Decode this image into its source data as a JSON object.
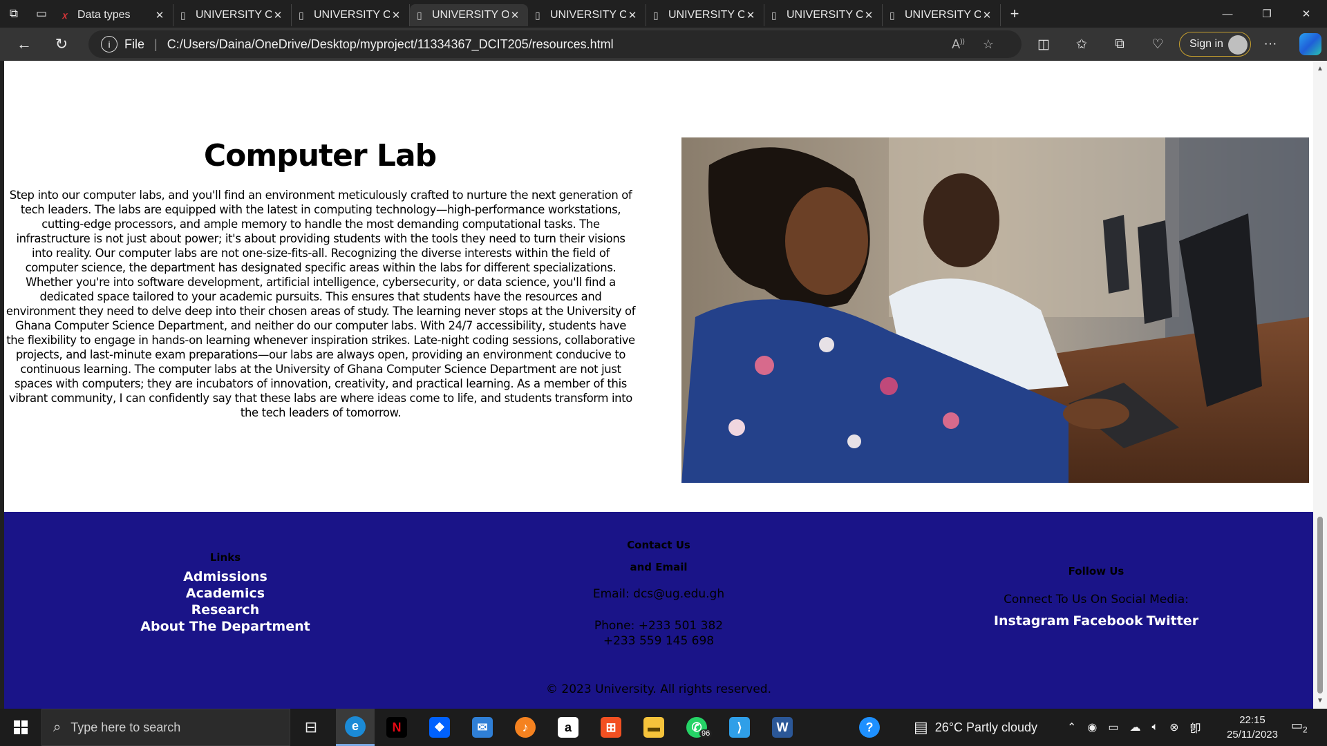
{
  "browser": {
    "tabs": [
      {
        "title": "Data types",
        "active": false
      },
      {
        "title": "UNIVERSITY OF GHANA",
        "active": false
      },
      {
        "title": "UNIVERSITY OF GHANA",
        "active": false
      },
      {
        "title": "UNIVERSITY OF GHANA",
        "active": true
      },
      {
        "title": "UNIVERSITY OF GHANA",
        "active": false
      },
      {
        "title": "UNIVERSITY OF GHANA",
        "active": false
      },
      {
        "title": "UNIVERSITY OF GHANA",
        "active": false
      },
      {
        "title": "UNIVERSITY OF GHANA",
        "active": false
      }
    ],
    "address": {
      "scheme_label": "File",
      "url": "C:/Users/Daina/OneDrive/Desktop/myproject/11334367_DCIT205/resources.html"
    },
    "signin_label": "Sign in"
  },
  "page": {
    "lab": {
      "title": "Computer Lab",
      "paragraph": "Step into our computer labs, and you'll find an environment meticulously crafted to nurture the next generation of tech leaders. The labs are equipped with the latest in computing technology—high-performance workstations, cutting-edge processors, and ample memory to handle the most demanding computational tasks. The infrastructure is not just about power; it's about providing students with the tools they need to turn their visions into reality. Our computer labs are not one-size-fits-all. Recognizing the diverse interests within the field of computer science, the department has designated specific areas within the labs for different specializations. Whether you're into software development, artificial intelligence, cybersecurity, or data science, you'll find a dedicated space tailored to your academic pursuits. This ensures that students have the resources and environment they need to delve deep into their chosen areas of study. The learning never stops at the University of Ghana Computer Science Department, and neither do our computer labs. With 24/7 accessibility, students have the flexibility to engage in hands-on learning whenever inspiration strikes. Late-night coding sessions, collaborative projects, and last-minute exam preparations—our labs are always open, providing an environment conducive to continuous learning. The computer labs at the University of Ghana Computer Science Department are not just spaces with computers; they are incubators of innovation, creativity, and practical learning. As a member of this vibrant community, I can confidently say that these labs are where ideas come to life, and students transform into the tech leaders of tomorrow."
    },
    "footer": {
      "links_heading": "Links",
      "links": [
        "Admissions",
        "Academics",
        "Research",
        "About The Department"
      ],
      "contact_heading_1": "Contact Us",
      "contact_heading_2": "and Email",
      "email": "Email: dcs@ug.edu.gh",
      "phone_1": "Phone: +233 501 382",
      "phone_2": "+233 559 145 698",
      "follow_heading": "Follow Us",
      "social_text": "Connect To Us On Social Media:",
      "social_links": [
        "Instagram",
        "Facebook",
        "Twitter"
      ],
      "copyright": "© 2023 University. All rights reserved."
    }
  },
  "taskbar": {
    "search_placeholder": "Type here to search",
    "whatsapp_badge": "96",
    "weather": "26°C  Partly cloudy",
    "time": "22:15",
    "date": "25/11/2023",
    "notifications": "2",
    "colors": {
      "edge": "#1b8ad6",
      "netflix": "#e50914",
      "dropbox": "#0061fe",
      "mail": "#2f7fd6",
      "amazon": "#ffffff",
      "store": "#f25022",
      "explorer": "#f5c33b",
      "whatsapp": "#25d366",
      "vscode": "#2f9fe8",
      "word": "#2b5797",
      "help": "#1e90ff"
    }
  },
  "colors": {
    "footer_bg": "#1a1488",
    "page_bg": "#ffffff",
    "browser_chrome": "#202020"
  }
}
